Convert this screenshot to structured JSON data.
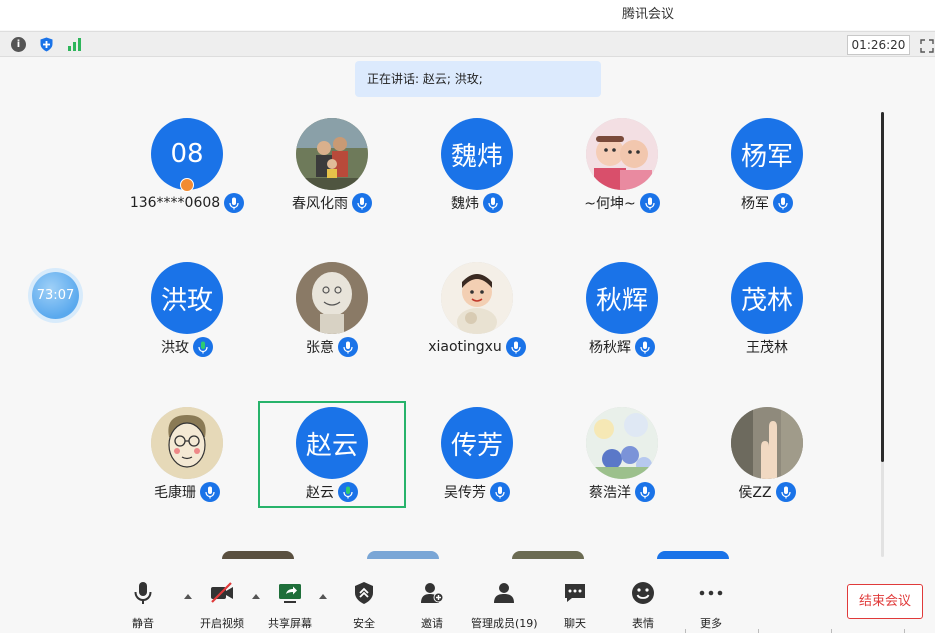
{
  "window": {
    "title": "腾讯会议"
  },
  "infobar": {
    "timer": "01:26:20"
  },
  "speaking": {
    "text": "正在讲话: 赵云; 洪玫;"
  },
  "bubble": {
    "text": "73:07"
  },
  "participants": [
    {
      "name": "136****0608",
      "avatar_text": "08",
      "avatar_type": "text"
    },
    {
      "name": "春风化雨",
      "avatar_type": "photo",
      "photo": "family-icon"
    },
    {
      "name": "魏炜",
      "avatar_text": "魏炜",
      "avatar_type": "text"
    },
    {
      "name": "~何坤~",
      "avatar_type": "photo",
      "photo": "twin-babies-icon"
    },
    {
      "name": "杨军",
      "avatar_text": "杨军",
      "avatar_type": "text"
    },
    {
      "name": "洪玫",
      "avatar_text": "洪玫",
      "avatar_type": "text"
    },
    {
      "name": "张意",
      "avatar_type": "photo",
      "photo": "paper-figure-icon"
    },
    {
      "name": "xiaotingxu",
      "avatar_type": "photo",
      "photo": "child-icon"
    },
    {
      "name": "杨秋辉",
      "avatar_text": "秋辉",
      "avatar_type": "text"
    },
    {
      "name": "王茂林",
      "avatar_text": "茂林",
      "avatar_type": "text"
    },
    {
      "name": "毛康珊",
      "avatar_type": "photo",
      "photo": "cartoon-face-icon"
    },
    {
      "name": "赵云",
      "avatar_text": "赵云",
      "avatar_type": "text"
    },
    {
      "name": "吴传芳",
      "avatar_text": "传芳",
      "avatar_type": "text"
    },
    {
      "name": "蔡浩洋",
      "avatar_type": "photo",
      "photo": "flowers-icon"
    },
    {
      "name": "侯ZZ",
      "avatar_type": "photo",
      "photo": "hand-icon"
    }
  ],
  "toolbar": {
    "mute": "静音",
    "video": "开启视频",
    "share": "共享屏幕",
    "security": "安全",
    "invite": "邀请",
    "members": "管理成员(19)",
    "chat": "聊天",
    "reaction": "表情",
    "more": "更多",
    "end_meeting": "结束会议"
  },
  "colors": {
    "accent": "#1a73e8",
    "active_speaker_border": "#27b36b",
    "end_button": "#e03a3a",
    "speaking_bg": "#dceafd"
  }
}
